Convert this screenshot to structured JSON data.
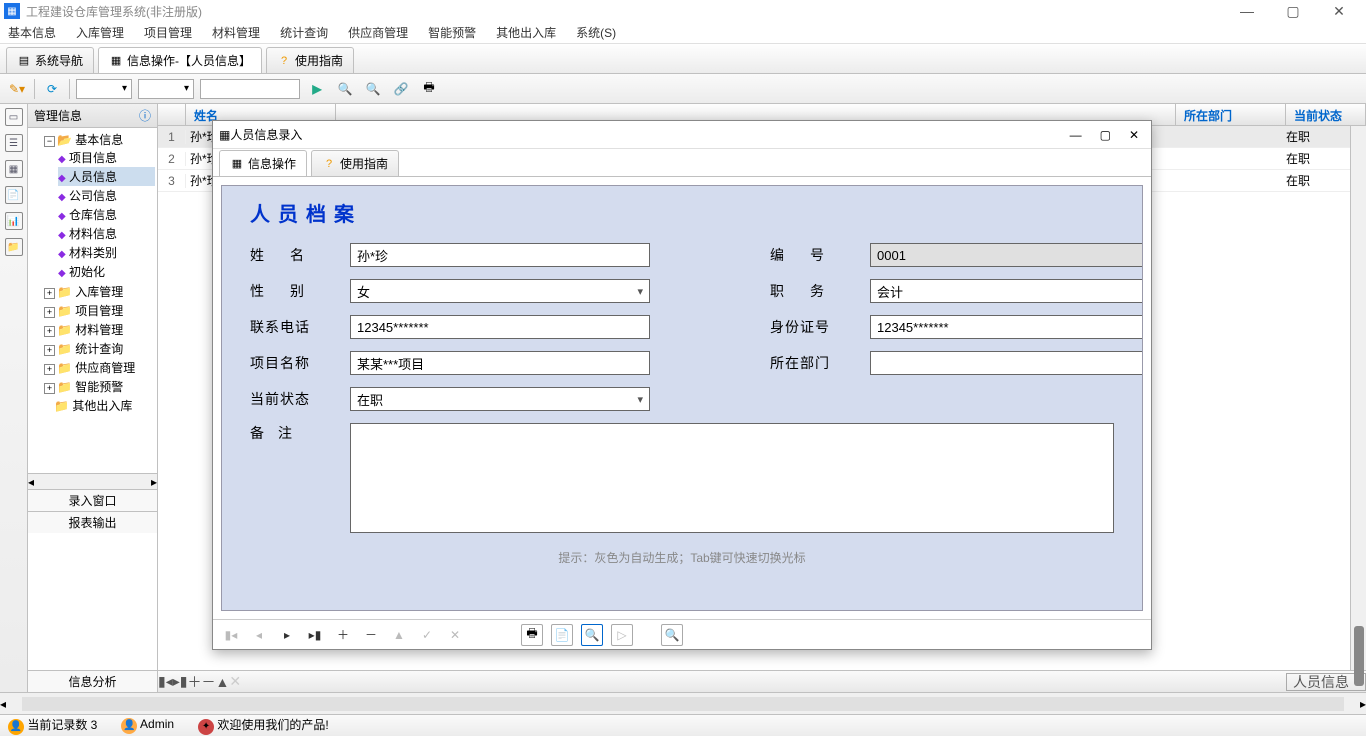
{
  "app": {
    "title": "工程建设仓库管理系统(非注册版)"
  },
  "menus": [
    "基本信息",
    "入库管理",
    "项目管理",
    "材料管理",
    "统计查询",
    "供应商管理",
    "智能预警",
    "其他出入库",
    "系统(S)"
  ],
  "maintabs": {
    "nav": "系统导航",
    "info_op": "信息操作-【人员信息】",
    "guide": "使用指南"
  },
  "sidebar": {
    "title": "管理信息",
    "root": "基本信息",
    "leaves": [
      "项目信息",
      "人员信息",
      "公司信息",
      "仓库信息",
      "材料信息",
      "材料类别",
      "初始化"
    ],
    "folders": [
      "入库管理",
      "项目管理",
      "材料管理",
      "统计查询",
      "供应商管理",
      "智能预警",
      "其他出入库"
    ],
    "panels": [
      "录入窗口",
      "报表输出",
      "信息分析"
    ]
  },
  "grid": {
    "cols": {
      "name": "姓名",
      "dept": "所在部门",
      "status": "当前状态"
    },
    "rows": [
      {
        "n": "1",
        "name": "孙*珍",
        "status": "在职"
      },
      {
        "n": "2",
        "name": "孙*珍",
        "status": "在职"
      },
      {
        "n": "3",
        "name": "孙*珍",
        "status": "在职"
      }
    ]
  },
  "dialog": {
    "title": "人员信息录入",
    "tabs": {
      "op": "信息操作",
      "guide": "使用指南"
    },
    "heading": "人员档案",
    "labels": {
      "name": "姓　名",
      "id": "编　号",
      "gender": "性　别",
      "role": "职　务",
      "phone": "联系电话",
      "idno": "身份证号",
      "project": "项目名称",
      "dept": "所在部门",
      "status": "当前状态",
      "remark": "备　注"
    },
    "values": {
      "name": "孙*珍",
      "id": "0001",
      "gender": "女",
      "role": "会计",
      "phone": "12345*******",
      "idno": "12345*******",
      "project": "某某***项目",
      "dept": "",
      "status": "在职"
    },
    "hint": "提示：灰色为自动生成；Tab键可快速切换光标"
  },
  "statusbar": {
    "records": "当前记录数 3",
    "user": "Admin",
    "welcome": "欢迎使用我们的产品!",
    "dropdown": "人员信息"
  }
}
